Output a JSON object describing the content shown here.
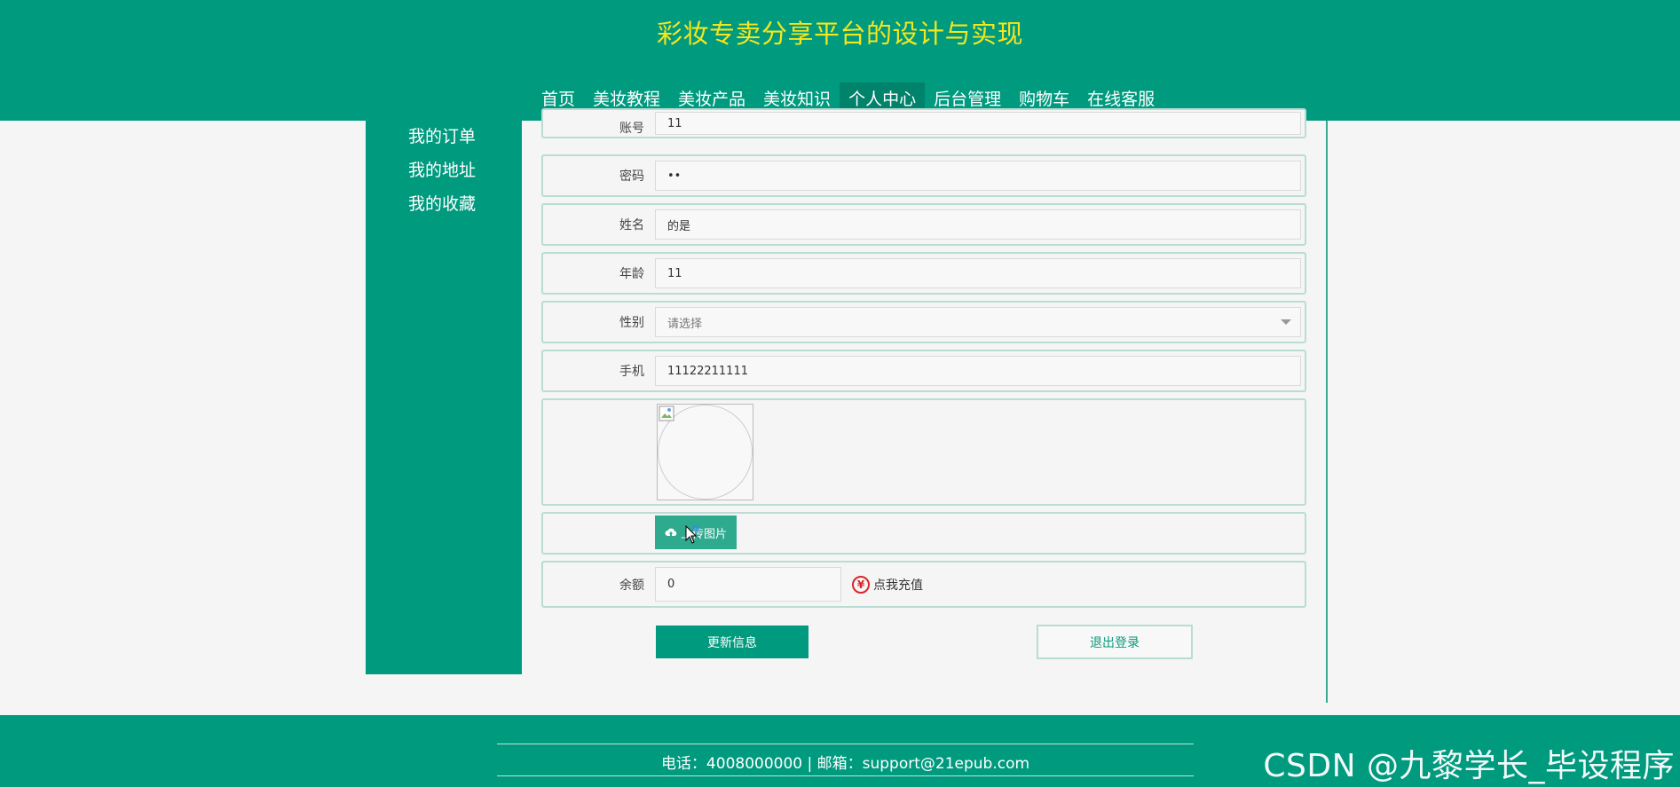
{
  "site": {
    "title": "彩妆专卖分享平台的设计与实现"
  },
  "nav": {
    "items": [
      "首页",
      "美妆教程",
      "美妆产品",
      "美妆知识",
      "个人中心",
      "后台管理",
      "购物车",
      "在线客服"
    ],
    "active": "个人中心"
  },
  "sidebar": {
    "items": [
      "我的订单",
      "我的地址",
      "我的收藏"
    ]
  },
  "form": {
    "account": {
      "label": "账号",
      "value": "11"
    },
    "password": {
      "label": "密码",
      "value": "••"
    },
    "name": {
      "label": "姓名",
      "value": "的是"
    },
    "age": {
      "label": "年龄",
      "value": "11"
    },
    "gender": {
      "label": "性别",
      "placeholder": "请选择"
    },
    "phone": {
      "label": "手机",
      "value": "11122211111"
    },
    "upload_label": "上传图片",
    "balance": {
      "label": "余额",
      "value": "0"
    },
    "recharge_label": "点我充值",
    "update_button": "更新信息",
    "logout_button": "退出登录"
  },
  "footer": {
    "contact": "电话：4008000000 | 邮箱：support@21epub.com"
  },
  "watermark": "CSDN @九黎学长_毕设程序",
  "colors": {
    "primary": "#009a7f",
    "title": "#f5e61e",
    "danger": "#d9262a"
  },
  "icons": [
    "upload-cloud-icon",
    "yen-icon",
    "dropdown-arrow-icon",
    "cursor-icon",
    "broken-image-icon"
  ]
}
